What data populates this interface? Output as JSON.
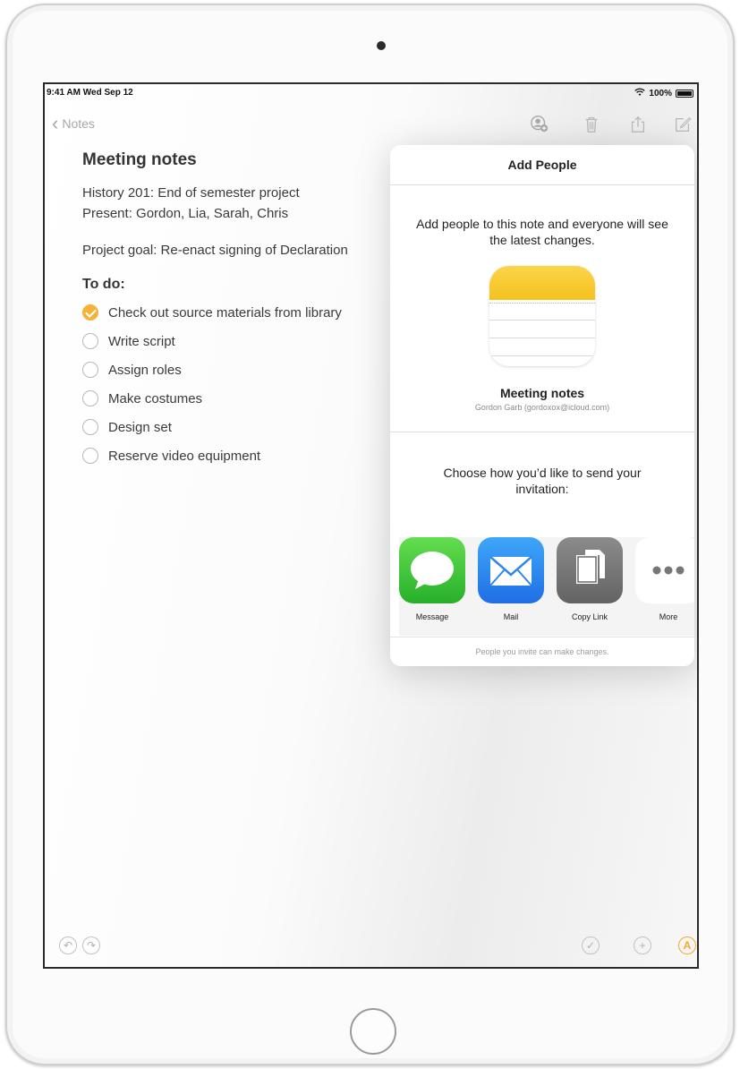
{
  "status_bar": {
    "time_date": "9:41 AM  Wed Sep 12",
    "battery": "100%"
  },
  "nav": {
    "back_label": "Notes"
  },
  "note": {
    "title": "Meeting notes",
    "lines": [
      "History 201: End of semester project",
      "Present: Gordon, Lia, Sarah, Chris",
      "Project goal: Re-enact signing of Declaration"
    ],
    "todo_heading": "To do:",
    "todos": [
      {
        "text": "Check out source materials from library",
        "done": true
      },
      {
        "text": "Write script",
        "done": false
      },
      {
        "text": "Assign roles",
        "done": false
      },
      {
        "text": "Make costumes",
        "done": false
      },
      {
        "text": "Design set",
        "done": false
      },
      {
        "text": "Reserve video equipment",
        "done": false
      }
    ]
  },
  "popover": {
    "title": "Add People",
    "description": "Add people to this note and everyone will see the latest changes.",
    "note_title": "Meeting notes",
    "owner": "Gordon Garb (gordoxox@icloud.com)",
    "choose_text": "Choose how you’d like to send your invitation:",
    "share_options": [
      {
        "label": "Message",
        "icon": "message-icon"
      },
      {
        "label": "Mail",
        "icon": "mail-icon"
      },
      {
        "label": "Copy Link",
        "icon": "copy-link-icon"
      },
      {
        "label": "More",
        "icon": "more-icon"
      }
    ],
    "footer": "People you invite can make changes."
  },
  "colors": {
    "accent": "#f4b23a",
    "screen_border": "#2a2a2a"
  }
}
